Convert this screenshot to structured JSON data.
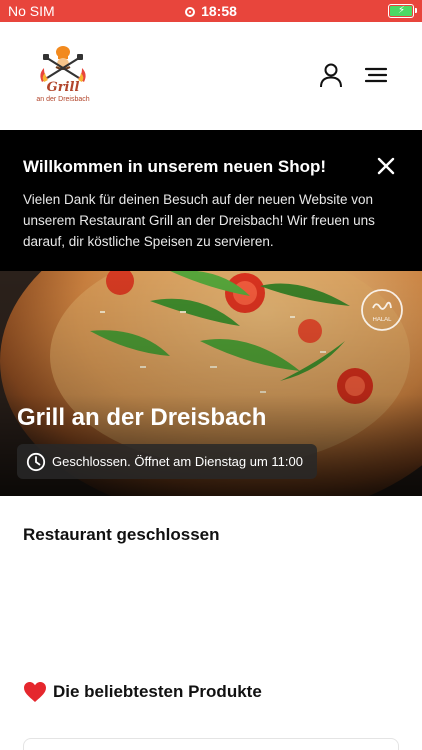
{
  "status_bar": {
    "carrier": "No SIM",
    "time": "18:58",
    "battery_color": "#4cd964",
    "background": "#e8453c"
  },
  "header": {
    "logo": {
      "name": "Grill",
      "tagline": "an der Dreisbach",
      "icon": "chef-grill-logo"
    },
    "icons": [
      "user-icon",
      "menu-icon"
    ]
  },
  "banner": {
    "title": "Willkommen in unserem neuen Shop!",
    "text": "Vielen Dank für deinen Besuch auf der neuen Website von unserem Restaurant Grill an der Dreisbach! Wir freuen uns darauf, dir köstliche Speisen zu servieren.",
    "close_icon": "close-icon"
  },
  "hero": {
    "title": "Grill an der Dreisbach",
    "status": "Geschlossen. Öffnet am Dienstag um 11:00",
    "badge_text": "HALAL"
  },
  "closed_section": {
    "title": "Restaurant geschlossen"
  },
  "popular": {
    "icon": "heart-icon",
    "title": "Die beliebtesten Produkte"
  }
}
